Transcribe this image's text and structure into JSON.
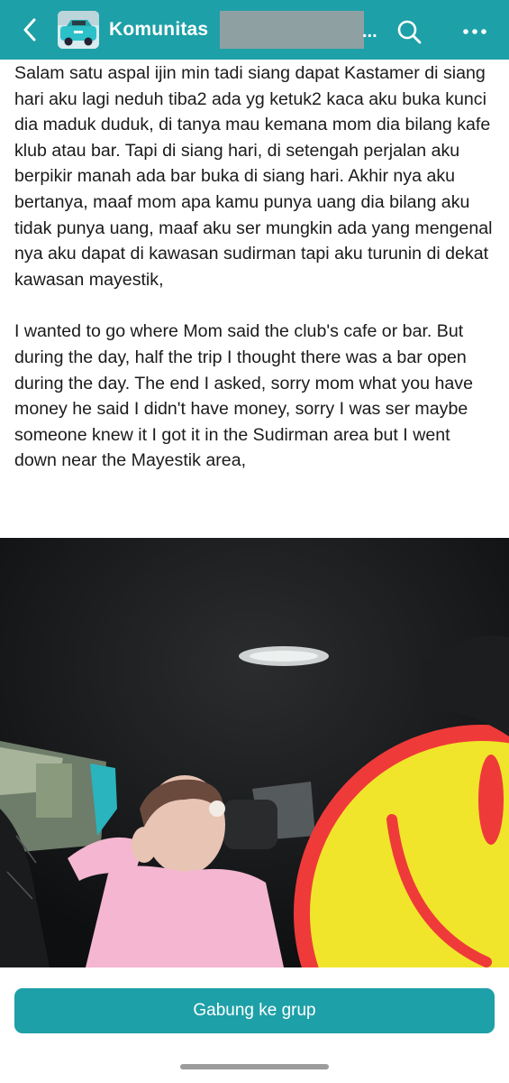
{
  "header": {
    "title": "Komunitas",
    "truncation": "...",
    "back_icon": "chevron-left-icon",
    "search_icon": "search-icon",
    "more_icon": "more-horizontal-icon",
    "color": "#1ea0a8"
  },
  "post": {
    "text_id": "Salam satu aspal ijin min tadi siang dapat Kastamer di siang hari aku lagi neduh tiba2 ada yg ketuk2 kaca aku buka kunci dia maduk duduk, di tanya mau kemana mom dia bilang kafe klub atau bar. Tapi di siang hari, di setengah perjalan aku berpikir manah ada bar buka di siang hari. Akhir nya aku bertanya, maaf mom apa kamu punya uang dia bilang aku tidak punya uang, maaf aku ser mungkin ada yang mengenal nya aku dapat di kawasan sudirman tapi aku turunin di dekat kawasan mayestik,",
    "text_en": "I wanted to go where Mom said the club's cafe or bar. But during the day, half the trip I thought there was a bar open during the day. The end I asked, sorry mom what you have money he said I didn't have money, sorry I was ser maybe someone knew it I got it in the Sudirman area but I went down near the Mayestik area,"
  },
  "join_button": {
    "label": "Gabung ke grup",
    "color": "#1ea0a8"
  }
}
